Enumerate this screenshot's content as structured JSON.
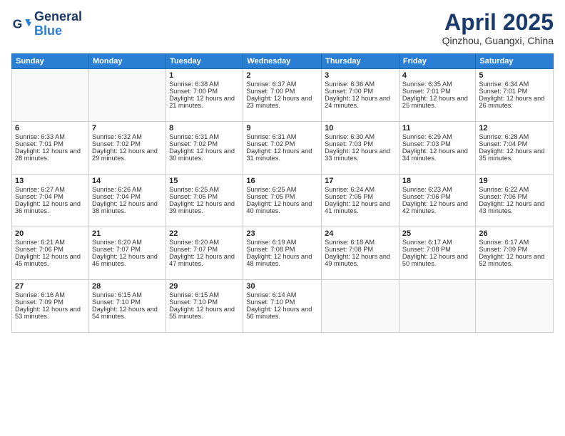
{
  "logo": {
    "line1": "General",
    "line2": "Blue"
  },
  "title": "April 2025",
  "subtitle": "Qinzhou, Guangxi, China",
  "days": [
    "Sunday",
    "Monday",
    "Tuesday",
    "Wednesday",
    "Thursday",
    "Friday",
    "Saturday"
  ],
  "weeks": [
    [
      {
        "num": "",
        "text": ""
      },
      {
        "num": "",
        "text": ""
      },
      {
        "num": "1",
        "text": "Sunrise: 6:38 AM\nSunset: 7:00 PM\nDaylight: 12 hours and 21 minutes."
      },
      {
        "num": "2",
        "text": "Sunrise: 6:37 AM\nSunset: 7:00 PM\nDaylight: 12 hours and 23 minutes."
      },
      {
        "num": "3",
        "text": "Sunrise: 6:36 AM\nSunset: 7:00 PM\nDaylight: 12 hours and 24 minutes."
      },
      {
        "num": "4",
        "text": "Sunrise: 6:35 AM\nSunset: 7:01 PM\nDaylight: 12 hours and 25 minutes."
      },
      {
        "num": "5",
        "text": "Sunrise: 6:34 AM\nSunset: 7:01 PM\nDaylight: 12 hours and 26 minutes."
      }
    ],
    [
      {
        "num": "6",
        "text": "Sunrise: 6:33 AM\nSunset: 7:01 PM\nDaylight: 12 hours and 28 minutes."
      },
      {
        "num": "7",
        "text": "Sunrise: 6:32 AM\nSunset: 7:02 PM\nDaylight: 12 hours and 29 minutes."
      },
      {
        "num": "8",
        "text": "Sunrise: 6:31 AM\nSunset: 7:02 PM\nDaylight: 12 hours and 30 minutes."
      },
      {
        "num": "9",
        "text": "Sunrise: 6:31 AM\nSunset: 7:02 PM\nDaylight: 12 hours and 31 minutes."
      },
      {
        "num": "10",
        "text": "Sunrise: 6:30 AM\nSunset: 7:03 PM\nDaylight: 12 hours and 33 minutes."
      },
      {
        "num": "11",
        "text": "Sunrise: 6:29 AM\nSunset: 7:03 PM\nDaylight: 12 hours and 34 minutes."
      },
      {
        "num": "12",
        "text": "Sunrise: 6:28 AM\nSunset: 7:04 PM\nDaylight: 12 hours and 35 minutes."
      }
    ],
    [
      {
        "num": "13",
        "text": "Sunrise: 6:27 AM\nSunset: 7:04 PM\nDaylight: 12 hours and 36 minutes."
      },
      {
        "num": "14",
        "text": "Sunrise: 6:26 AM\nSunset: 7:04 PM\nDaylight: 12 hours and 38 minutes."
      },
      {
        "num": "15",
        "text": "Sunrise: 6:25 AM\nSunset: 7:05 PM\nDaylight: 12 hours and 39 minutes."
      },
      {
        "num": "16",
        "text": "Sunrise: 6:25 AM\nSunset: 7:05 PM\nDaylight: 12 hours and 40 minutes."
      },
      {
        "num": "17",
        "text": "Sunrise: 6:24 AM\nSunset: 7:05 PM\nDaylight: 12 hours and 41 minutes."
      },
      {
        "num": "18",
        "text": "Sunrise: 6:23 AM\nSunset: 7:06 PM\nDaylight: 12 hours and 42 minutes."
      },
      {
        "num": "19",
        "text": "Sunrise: 6:22 AM\nSunset: 7:06 PM\nDaylight: 12 hours and 43 minutes."
      }
    ],
    [
      {
        "num": "20",
        "text": "Sunrise: 6:21 AM\nSunset: 7:06 PM\nDaylight: 12 hours and 45 minutes."
      },
      {
        "num": "21",
        "text": "Sunrise: 6:20 AM\nSunset: 7:07 PM\nDaylight: 12 hours and 46 minutes."
      },
      {
        "num": "22",
        "text": "Sunrise: 6:20 AM\nSunset: 7:07 PM\nDaylight: 12 hours and 47 minutes."
      },
      {
        "num": "23",
        "text": "Sunrise: 6:19 AM\nSunset: 7:08 PM\nDaylight: 12 hours and 48 minutes."
      },
      {
        "num": "24",
        "text": "Sunrise: 6:18 AM\nSunset: 7:08 PM\nDaylight: 12 hours and 49 minutes."
      },
      {
        "num": "25",
        "text": "Sunrise: 6:17 AM\nSunset: 7:08 PM\nDaylight: 12 hours and 50 minutes."
      },
      {
        "num": "26",
        "text": "Sunrise: 6:17 AM\nSunset: 7:09 PM\nDaylight: 12 hours and 52 minutes."
      }
    ],
    [
      {
        "num": "27",
        "text": "Sunrise: 6:16 AM\nSunset: 7:09 PM\nDaylight: 12 hours and 53 minutes."
      },
      {
        "num": "28",
        "text": "Sunrise: 6:15 AM\nSunset: 7:10 PM\nDaylight: 12 hours and 54 minutes."
      },
      {
        "num": "29",
        "text": "Sunrise: 6:15 AM\nSunset: 7:10 PM\nDaylight: 12 hours and 55 minutes."
      },
      {
        "num": "30",
        "text": "Sunrise: 6:14 AM\nSunset: 7:10 PM\nDaylight: 12 hours and 56 minutes."
      },
      {
        "num": "",
        "text": ""
      },
      {
        "num": "",
        "text": ""
      },
      {
        "num": "",
        "text": ""
      }
    ]
  ]
}
